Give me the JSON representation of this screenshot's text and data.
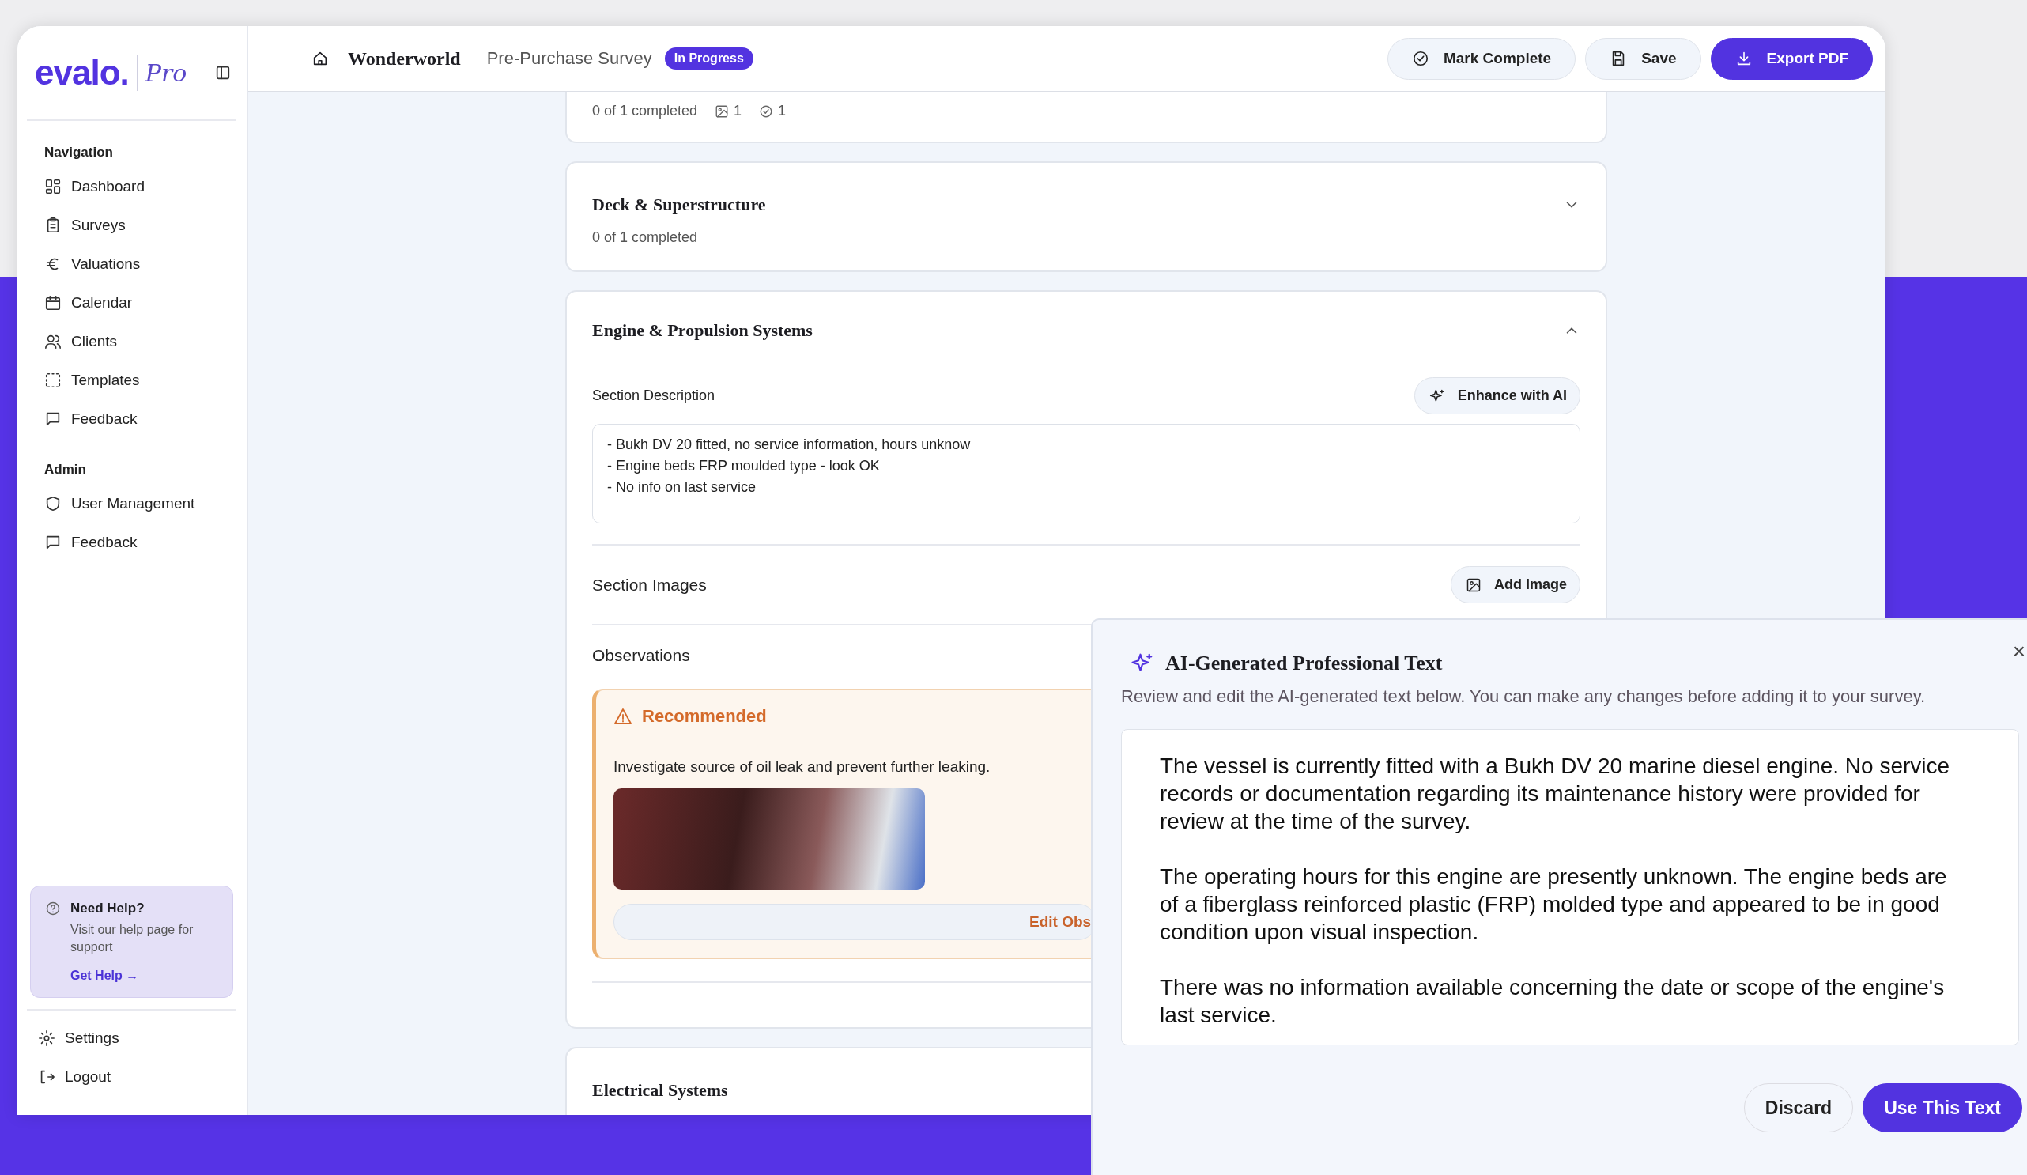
{
  "sidebar": {
    "logo": "evalo.",
    "logo_suffix": "Pro",
    "sections": [
      {
        "heading": "Navigation",
        "items": [
          "Dashboard",
          "Surveys",
          "Valuations",
          "Calendar",
          "Clients",
          "Templates",
          "Feedback"
        ]
      },
      {
        "heading": "Admin",
        "items": [
          "User Management",
          "Feedback"
        ]
      }
    ],
    "help": {
      "title": "Need Help?",
      "text": "Visit our help page for support",
      "link": "Get Help →"
    },
    "footer_items": [
      "Settings",
      "Logout"
    ]
  },
  "header": {
    "vessel": "Wonderworld",
    "survey": "Pre-Purchase Survey",
    "status": "In Progress",
    "actions": [
      {
        "label": "Mark Complete",
        "kind": "secondary"
      },
      {
        "label": "Save",
        "kind": "secondary"
      },
      {
        "label": "Export PDF",
        "kind": "primary"
      }
    ]
  },
  "sections": [
    {
      "progress": "0 of 1 completed",
      "image_count": "1",
      "check_count": "1"
    },
    {
      "title": "Deck & Superstructure",
      "progress": "0 of 1 completed",
      "expanded": false
    },
    {
      "title": "Engine & Propulsion Systems",
      "expanded": true,
      "description_label": "Section Description",
      "enhance_button": "Enhance with AI",
      "description": "- Bukh DV 20 fitted, no service information, hours unknow\n- Engine beds FRP moulded type - look OK\n- No info on last service",
      "images_label": "Section Images",
      "add_image_button": "Add Image",
      "observations_label": "Observations",
      "observations": [
        {
          "severity": "Recommended",
          "text": "Investigate source of oil leak and prevent further leaking.",
          "edit_button": "Edit Obs"
        }
      ]
    },
    {
      "title": "Electrical Systems"
    }
  ],
  "ai_panel": {
    "title": "AI-Generated Professional Text",
    "subtitle": "Review and edit the AI-generated text below. You can make any changes before adding it to your survey.",
    "close": "×",
    "paragraphs": [
      "The vessel is currently fitted with a Bukh DV 20 marine diesel engine. No service records or documentation regarding its maintenance history were provided for review at the time of the survey.",
      "The operating hours for this engine are presently unknown. The engine beds are of a fiberglass reinforced plastic (FRP) molded type and appeared to be in good condition upon visual inspection.",
      "There was no information available concerning the date or scope of the engine's last service."
    ],
    "buttons": [
      {
        "label": "Discard",
        "kind": "secondary"
      },
      {
        "label": "Use This Text",
        "kind": "primary"
      }
    ]
  }
}
